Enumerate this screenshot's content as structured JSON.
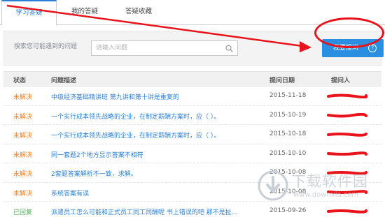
{
  "tabs": [
    {
      "label": "学习答疑",
      "active": true
    },
    {
      "label": "我的答疑",
      "active": false
    },
    {
      "label": "答疑收藏",
      "active": false
    }
  ],
  "search": {
    "label": "搜索您可能遇到的问题",
    "placeholder": "请输入问题",
    "ask_label": "我要提问",
    "help_glyph": "?"
  },
  "table": {
    "headers": {
      "status": "状态",
      "desc": "问题描述",
      "date": "提问日期",
      "asker": "提问人"
    },
    "rows": [
      {
        "status": "未解决",
        "desc": "中级经济基础精讲班 第九讲和第十讲是重复的",
        "date": "2015-11-18"
      },
      {
        "status": "未解决",
        "desc": "一个实行成本领先战略的企业，在制定薪酬方案时，应（ ）。",
        "date": "2015-10-19"
      },
      {
        "status": "未解决",
        "desc": "一个实行成本领先战略的企业，在制定薪酬方案时，应（ ）。",
        "date": "2015-10-18"
      },
      {
        "status": "未解决",
        "desc": "同一套题2个地方显示答案不相符",
        "date": "2015-10-10"
      },
      {
        "status": "未解决",
        "desc": "2套题答案解析不一致，求解。",
        "date": "2015-10-08"
      },
      {
        "status": "未解决",
        "desc": "系统答案有误",
        "date": "2015-10-08"
      },
      {
        "status": "已回复",
        "desc": "派遣员工怎么可能和正式员工同工同酬呢 书上错误的吧 那不是扯...",
        "date": "2015-09-26"
      }
    ]
  },
  "watermark": {
    "title": "下载软件园",
    "url": "www.downxia.com"
  },
  "colors": {
    "accent": "#2a8fe0",
    "unresolved": "#ef7c21",
    "replied": "#4caf50",
    "annotation": "#e8131b"
  }
}
